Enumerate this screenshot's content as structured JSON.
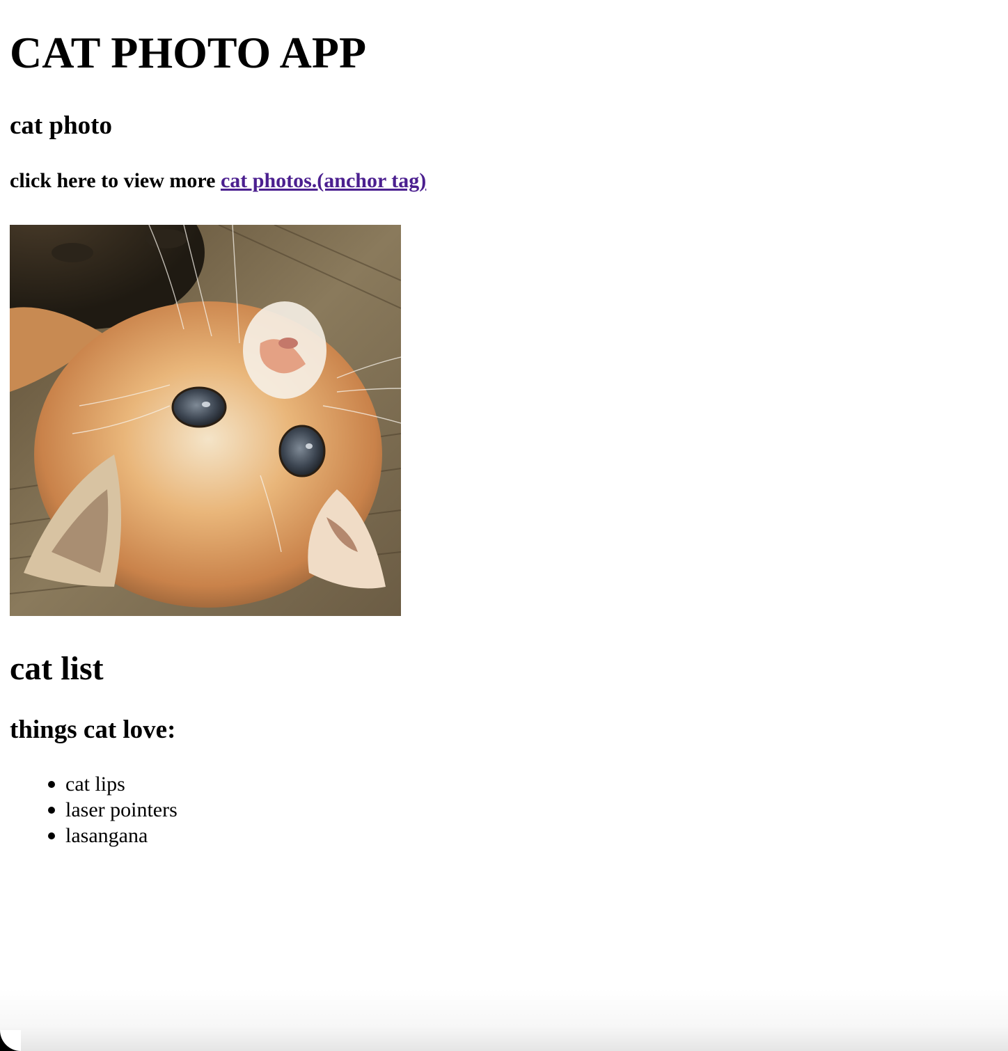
{
  "page": {
    "title": "CAT PHOTO APP"
  },
  "photo_section": {
    "heading": "cat photo",
    "more_prefix": "click here to view more ",
    "more_link": "cat photos.(anchor tag)",
    "image_icon": "cat-photo-image"
  },
  "list_section": {
    "heading": "cat list",
    "subheading": "things cat love:",
    "items": [
      "cat lips",
      "laser pointers",
      "lasangana"
    ]
  },
  "colors": {
    "text": "#000000",
    "link": "#4b1f8f",
    "background": "#ffffff"
  }
}
